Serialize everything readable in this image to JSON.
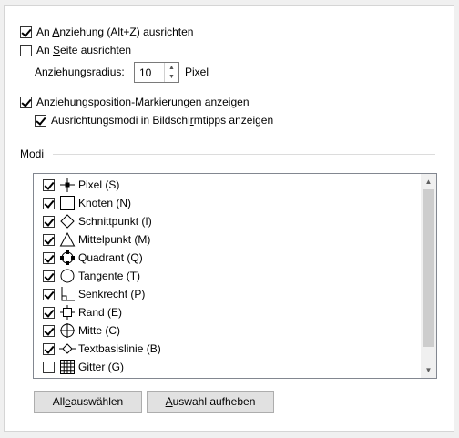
{
  "options": {
    "snap_to_object": {
      "pre": "An ",
      "acc": "A",
      "post": "nziehung  (Alt+Z) ausrichten",
      "checked": true
    },
    "snap_to_page": {
      "pre": "An ",
      "acc": "S",
      "post": "eite ausrichten",
      "checked": false
    },
    "snap_radius": {
      "label": "Anziehungsradius:",
      "value": "10",
      "unit": "Pixel"
    },
    "show_markers": {
      "text1": "Anziehungsposition-",
      "acc": "M",
      "text2": "arkierungen anzeigen",
      "checked": true
    },
    "show_tooltips": {
      "text1": "Ausrichtungsmodi in Bildschi",
      "acc": "r",
      "text2": "mtipps anzeigen",
      "checked": true
    }
  },
  "modes": {
    "title": "Modi",
    "items": [
      {
        "label": "Pixel (S)",
        "icon": "pixel-icon",
        "checked": true
      },
      {
        "label": "Knoten (N)",
        "icon": "node-icon",
        "checked": true
      },
      {
        "label": "Schnittpunkt (I)",
        "icon": "intersection-icon",
        "checked": true
      },
      {
        "label": "Mittelpunkt (M)",
        "icon": "midpoint-icon",
        "checked": true
      },
      {
        "label": "Quadrant (Q)",
        "icon": "quadrant-icon",
        "checked": true
      },
      {
        "label": "Tangente (T)",
        "icon": "tangent-icon",
        "checked": true
      },
      {
        "label": "Senkrecht (P)",
        "icon": "perpendicular-icon",
        "checked": true
      },
      {
        "label": "Rand (E)",
        "icon": "edge-icon",
        "checked": true
      },
      {
        "label": "Mitte (C)",
        "icon": "center-icon",
        "checked": true
      },
      {
        "label": "Textbasislinie (B)",
        "icon": "text-baseline-icon",
        "checked": true
      },
      {
        "label": "Gitter (G)",
        "icon": "grid-icon",
        "checked": false
      }
    ]
  },
  "buttons": {
    "select_all": {
      "pre": "All",
      "acc": "e",
      "post": " auswählen"
    },
    "deselect": {
      "pre": "",
      "acc": "A",
      "post": "uswahl aufheben"
    }
  }
}
